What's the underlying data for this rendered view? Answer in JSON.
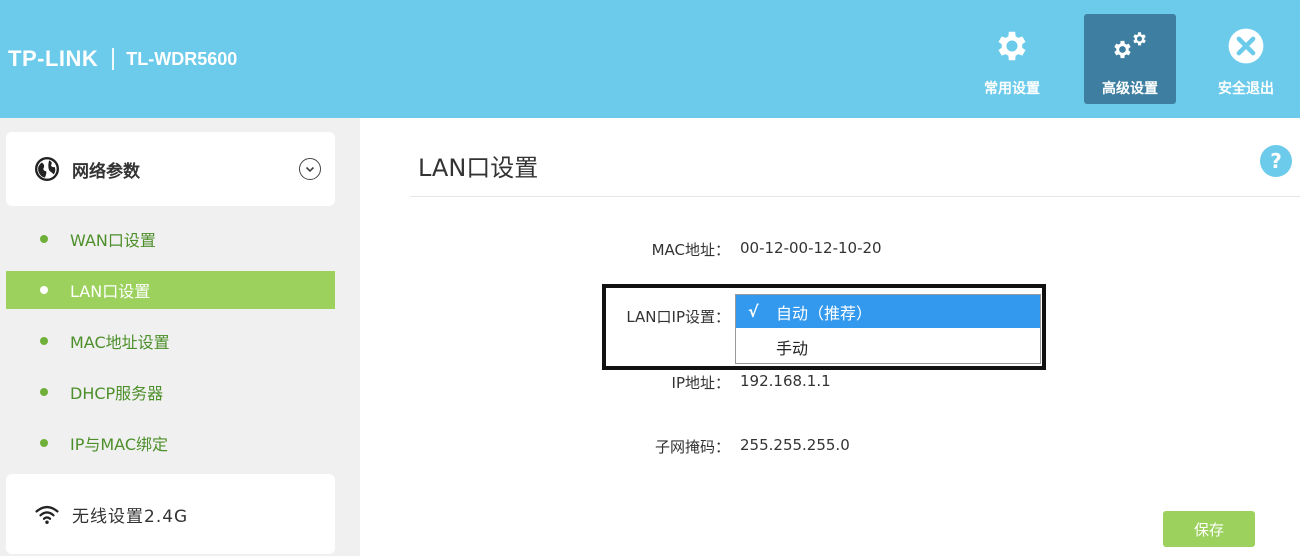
{
  "header": {
    "brand": "TP-LINK",
    "model": "TL-WDR5600",
    "nav": [
      {
        "label": "常用设置",
        "icon": "gear-icon"
      },
      {
        "label": "高级设置",
        "icon": "gears-icon"
      },
      {
        "label": "安全退出",
        "icon": "close-icon"
      }
    ]
  },
  "sidebar": {
    "group_network": "网络参数",
    "items": [
      {
        "label": "WAN口设置"
      },
      {
        "label": "LAN口设置"
      },
      {
        "label": "MAC地址设置"
      },
      {
        "label": "DHCP服务器"
      },
      {
        "label": "IP与MAC绑定"
      }
    ],
    "group_wireless": "无线设置2.4G"
  },
  "main": {
    "title": "LAN口设置",
    "help": "?",
    "mac_label": "MAC地址：",
    "mac_value": "00-12-00-12-10-20",
    "lan_ip_label": "LAN口IP设置：",
    "lan_ip_options": [
      {
        "check": "√",
        "label": "自动（推荐）"
      },
      {
        "label": "手动"
      }
    ],
    "ip_label": "IP地址：",
    "ip_value": "192.168.1.1",
    "mask_label": "子网掩码：",
    "mask_value": "255.255.255.0",
    "save": "保存"
  },
  "colors": {
    "header_bg": "#6ccbea",
    "active_nav": "#3e7fa1",
    "sidebar_active": "#9bd15c",
    "sidebar_text": "#4d8f2a",
    "dropdown_selected": "#3399ee"
  }
}
